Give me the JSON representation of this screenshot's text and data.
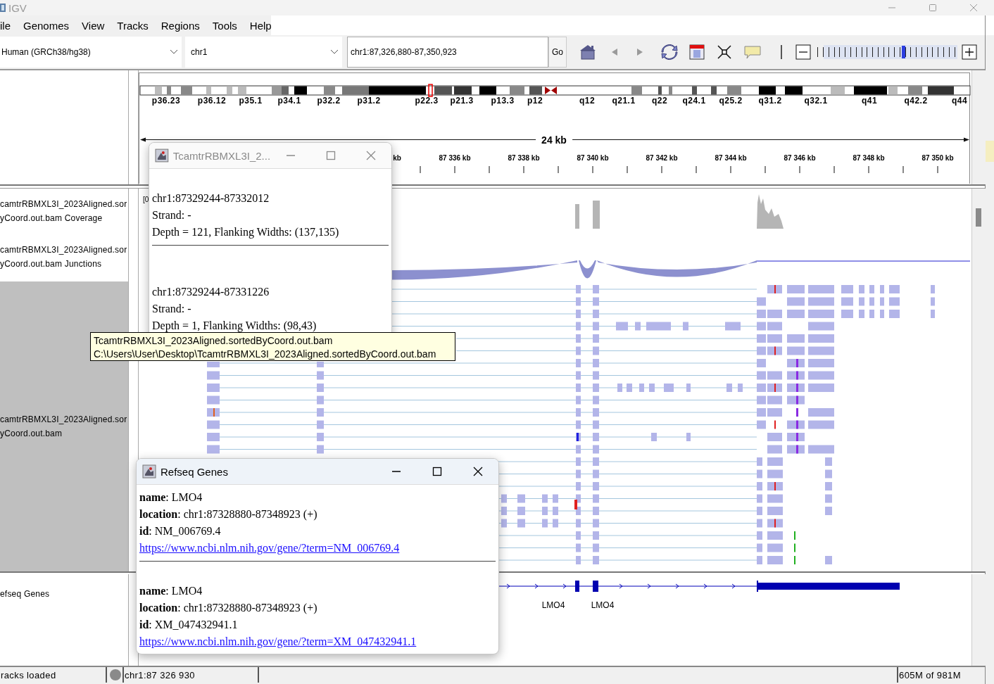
{
  "window": {
    "title": "IGV"
  },
  "menu": [
    "ile",
    "Genomes",
    "View",
    "Tracks",
    "Regions",
    "Tools",
    "Help"
  ],
  "toolbar": {
    "genome": "Human (GRCh38/hg38)",
    "chromosome": "chr1",
    "locus": "chr1:87,326,880-87,350,923",
    "go_button": "Go",
    "zoom": {
      "level": 0.61
    }
  },
  "ideogram": {
    "bands": [
      "p36.23",
      "p36.12",
      "p35.1",
      "p34.1",
      "p32.2",
      "p31.2",
      "p22.3",
      "p21.3",
      "p13.3",
      "p12",
      "q12",
      "q21.1",
      "q22",
      "q24.1",
      "q25.2",
      "q31.2",
      "q32.1",
      "q41",
      "q42.2",
      "q44"
    ]
  },
  "ruler": {
    "span": "24 kb",
    "tick_labels": [
      "kb",
      "87 336 kb",
      "87 338 kb",
      "87 340 kb",
      "87 342 kb",
      "87 344 kb",
      "87 346 kb",
      "87 348 kb",
      "87 350 kb"
    ]
  },
  "tracks": [
    {
      "kind": "coverage",
      "name_lines": [
        "camtrRBMXL3I_2023Aligned.sor",
        "yCoord.out.bam Coverage"
      ],
      "range": "[0"
    },
    {
      "kind": "junctions",
      "name_lines": [
        "camtrRBMXL3I_2023Aligned.sor",
        "yCoord.out.bam Junctions"
      ]
    },
    {
      "kind": "alignments",
      "name_lines": [
        "camtrRBMXL3I_2023Aligned.sor",
        "yCoord.out.bam"
      ]
    }
  ],
  "gene_track": {
    "name": "efseq Genes",
    "gene_labels": [
      "LMO4",
      "LMO4"
    ]
  },
  "junction_popup": {
    "title": "TcamtrRBMXL3I_2...",
    "entries": [
      {
        "lines": [
          "chr1:87329244-87332012",
          "Strand: -",
          "Depth = 121, Flanking Widths: (137,135)"
        ]
      },
      {
        "lines": [
          "chr1:87329244-87331226",
          "Strand: -",
          "Depth = 1, Flanking Widths: (98,43)"
        ]
      }
    ]
  },
  "tooltip": {
    "lines": [
      "TcamtrRBMXL3I_2023Aligned.sortedByCoord.out.bam",
      "C:\\Users\\User\\Desktop\\TcamtrRBMXL3I_2023Aligned.sortedByCoord.out.bam"
    ]
  },
  "gene_popup": {
    "title": "Refseq Genes",
    "entries": [
      {
        "lines": [
          "**name**: LMO4",
          "**location**: chr1:87328880-87348923 (+)",
          "**id**: NM_006769.4"
        ],
        "link": "https://www.ncbi.nlm.nih.gov/gene/?term=NM_006769.4"
      },
      {
        "lines": [
          "**name**: LMO4",
          "**location**: chr1:87328880-87348923 (+)",
          "**id**: XM_047432941.1"
        ],
        "link": "https://www.ncbi.nlm.nih.gov/gene/?term=XM_047432941.1"
      }
    ]
  },
  "status_bar": {
    "message": "racks loaded",
    "position": "chr1:87 326 930",
    "memory": "605M of 981M"
  }
}
